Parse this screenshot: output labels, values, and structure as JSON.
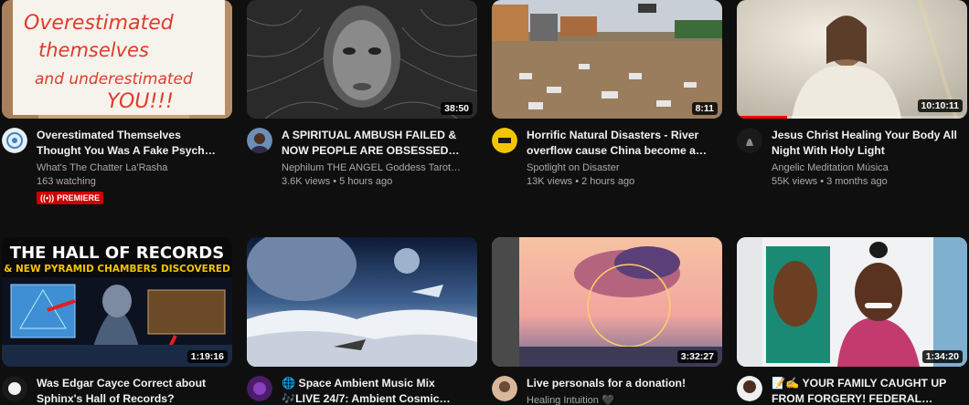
{
  "videos": [
    {
      "title": "Overestimated Themselves Thought You Was A Fake Psych…",
      "channel": "What's The Chatter La'Rasha",
      "stats": "163 watching",
      "badge": "PREMIERE",
      "badge_icon": "live-signal-icon",
      "thumb_text": [
        "Overestimated",
        "themselves",
        "and underestimated",
        "YOU!!!"
      ]
    },
    {
      "title": "A SPIRITUAL AMBUSH FAILED & NOW PEOPLE ARE OBSESSED…",
      "channel": "Nephilum THE ANGEL Goddess Tarot…",
      "stats": "3.6K views • 5 hours ago",
      "duration": "38:50"
    },
    {
      "title": "Horrific Natural Disasters - River overflow cause China become a…",
      "channel": "Spotlight on Disaster",
      "stats": "13K views • 2 hours ago",
      "duration": "8:11"
    },
    {
      "title": "Jesus Christ Healing Your Body All Night With Holy Light",
      "channel": "Angelic Meditation Música",
      "stats": "55K views • 3 months ago",
      "duration": "10:10:11",
      "progress": 0.22
    },
    {
      "title": "Was Edgar Cayce Correct about Sphinx's Hall of Records?",
      "duration": "1:19:16",
      "thumb_text": [
        "THE HALL OF RECORDS",
        "& NEW PYRAMID CHAMBERS DISCOVERED"
      ]
    },
    {
      "title": "🌐 Space Ambient Music Mix 🎶LIVE 24/7: Ambient Cosmic…"
    },
    {
      "title": "Live personals for a donation!",
      "channel": "Healing Intuition 🖤",
      "duration": "3:32:27"
    },
    {
      "title": "📝✍️ YOUR FAMILY CAUGHT UP FROM FORGERY! FEDERAL…",
      "duration": "1:34:20",
      "more_icon": "⋮"
    }
  ]
}
